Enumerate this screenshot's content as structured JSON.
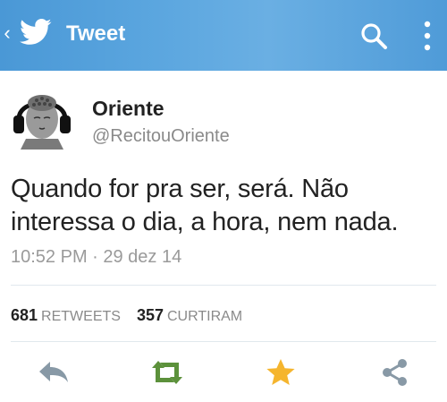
{
  "appbar": {
    "back_glyph": "‹",
    "title": "Tweet",
    "icons": [
      "back-chevron-icon",
      "twitter-bird-icon",
      "search-icon",
      "overflow-menu-icon"
    ]
  },
  "tweet": {
    "author_name": "Oriente",
    "author_handle": "@RecitouOriente",
    "text": "Quando for pra ser, será. Não interessa o dia, a hora, nem nada.",
    "timestamp": "10:52 PM · 29 dez 14"
  },
  "stats": {
    "retweets_count": "681",
    "retweets_label": "RETWEETS",
    "likes_count": "357",
    "likes_label": "CURTIRAM"
  },
  "actions": {
    "icons": [
      "reply-icon",
      "retweet-icon",
      "favorite-star-icon",
      "share-icon"
    ]
  },
  "colors": {
    "header": "#55a2dd",
    "retweet_green": "#5c913b",
    "star_gold": "#f5b52e",
    "action_gray": "#8899a6"
  }
}
